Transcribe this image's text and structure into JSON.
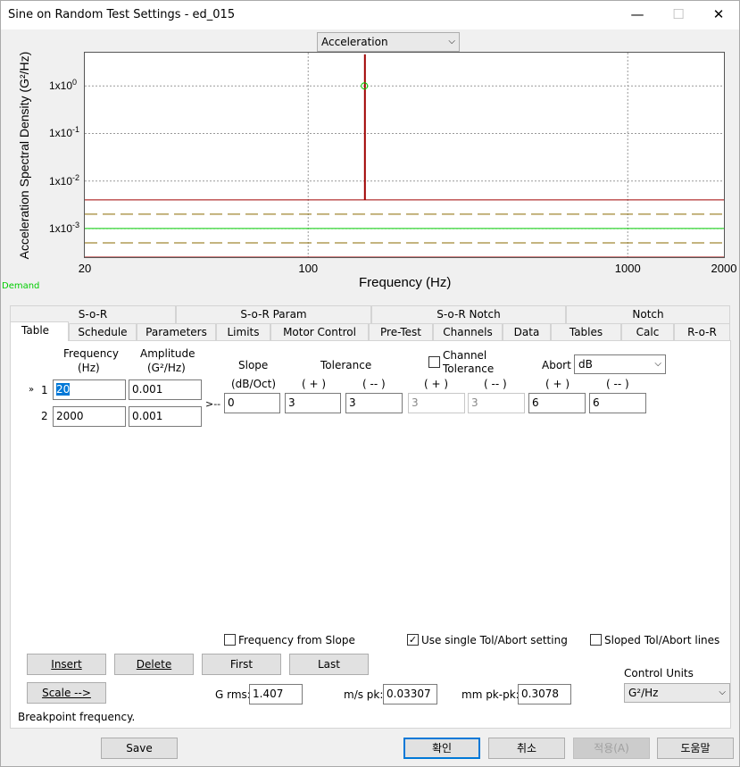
{
  "window": {
    "title": "Sine on Random Test Settings - ed_015",
    "min_glyph": "—",
    "max_glyph": "☐",
    "close_glyph": "✕"
  },
  "chart_selector": {
    "value": "Acceleration"
  },
  "chart_data": {
    "type": "line",
    "xlabel": "Frequency (Hz)",
    "ylabel": "Acceleration Spectral Density (G²/Hz)",
    "x_scale": "log",
    "y_scale": "log",
    "xlim": [
      20,
      2000
    ],
    "ylim": [
      0.00025,
      5
    ],
    "x_ticks": [
      "20",
      "100",
      "1000",
      "2000"
    ],
    "y_ticks": [
      "1x10-3",
      "1x10-2",
      "1x10-1",
      "1x100"
    ],
    "y_tick_values": [
      0.001,
      0.01,
      0.1,
      1
    ],
    "grid": true,
    "side_label": "Demand",
    "series": [
      {
        "name": "Demand",
        "color": "#00cc00",
        "dash": "solid",
        "x": [
          20,
          2000
        ],
        "y": [
          0.001,
          0.001
        ]
      },
      {
        "color": "#a00000",
        "dash": "solid",
        "x": [
          20,
          150,
          150,
          151,
          151,
          2000
        ],
        "y": [
          0.004,
          0.004,
          4.5,
          4.5,
          0.004,
          0.004
        ]
      },
      {
        "color": "#a00000",
        "dash": "solid",
        "x": [
          20,
          2000
        ],
        "y": [
          0.00025,
          0.00025
        ]
      },
      {
        "color": "#8a6a00",
        "dash": "dashed",
        "x": [
          20,
          2000
        ],
        "y": [
          0.002,
          0.002
        ]
      },
      {
        "color": "#8a6a00",
        "dash": "dashed",
        "x": [
          20,
          2000
        ],
        "y": [
          0.0005,
          0.0005
        ]
      }
    ],
    "tone_marker": {
      "x": 150,
      "y": 1,
      "color": "#00cc00"
    }
  },
  "tabs_row1": [
    "S-o-R",
    "S-o-R Param",
    "S-o-R Notch",
    "Notch"
  ],
  "tabs_row2": [
    "Table",
    "Schedule",
    "Parameters",
    "Limits",
    "Motor Control",
    "Pre-Test",
    "Channels",
    "Data",
    "Tables",
    "Calc",
    "R-o-R"
  ],
  "table": {
    "freq_header": "Frequency",
    "freq_unit": "(Hz)",
    "amp_header": "Amplitude",
    "amp_unit": "(G²/Hz)",
    "slope_header": "Slope",
    "slope_unit": "(dB/Oct)",
    "tolerance_header": "Tolerance",
    "channel_tol_label_1": "Channel",
    "channel_tol_label_2": "Tolerance",
    "abort_label": "Abort",
    "abort_value": "dB",
    "plus_label": "( + )",
    "minus_label": "( -- )",
    "row_marker": "»",
    "between_marker": ">--",
    "rows": [
      {
        "index": "1",
        "frequency": "20",
        "amplitude": "0.001"
      },
      {
        "index": "2",
        "frequency": "2000",
        "amplitude": "0.001"
      }
    ],
    "segment": {
      "slope": "0",
      "tol_plus": "3",
      "tol_minus": "3",
      "ch_plus": "3",
      "ch_minus": "3",
      "abort_plus": "6",
      "abort_minus": "6"
    }
  },
  "options": {
    "freq_from_slope": "Frequency from Slope",
    "use_single": "Use single Tol/Abort setting",
    "use_single_check": "✓",
    "sloped_lines": "Sloped Tol/Abort lines"
  },
  "buttons": {
    "insert": "Insert",
    "delete": "Delete",
    "first": "First",
    "last": "Last",
    "scale": "Scale -->"
  },
  "stats": {
    "grms_label": "G rms:",
    "grms": "1.407",
    "ms_label": "m/s pk:",
    "ms": "0.03307",
    "mm_label": "mm pk-pk:",
    "mm": "0.3078"
  },
  "control_units": {
    "label": "Control Units",
    "value": "G²/Hz"
  },
  "status": "Breakpoint frequency.",
  "footer": {
    "save": "Save",
    "ok": "확인",
    "cancel": "취소",
    "apply": "적용(A)",
    "help": "도움말"
  }
}
